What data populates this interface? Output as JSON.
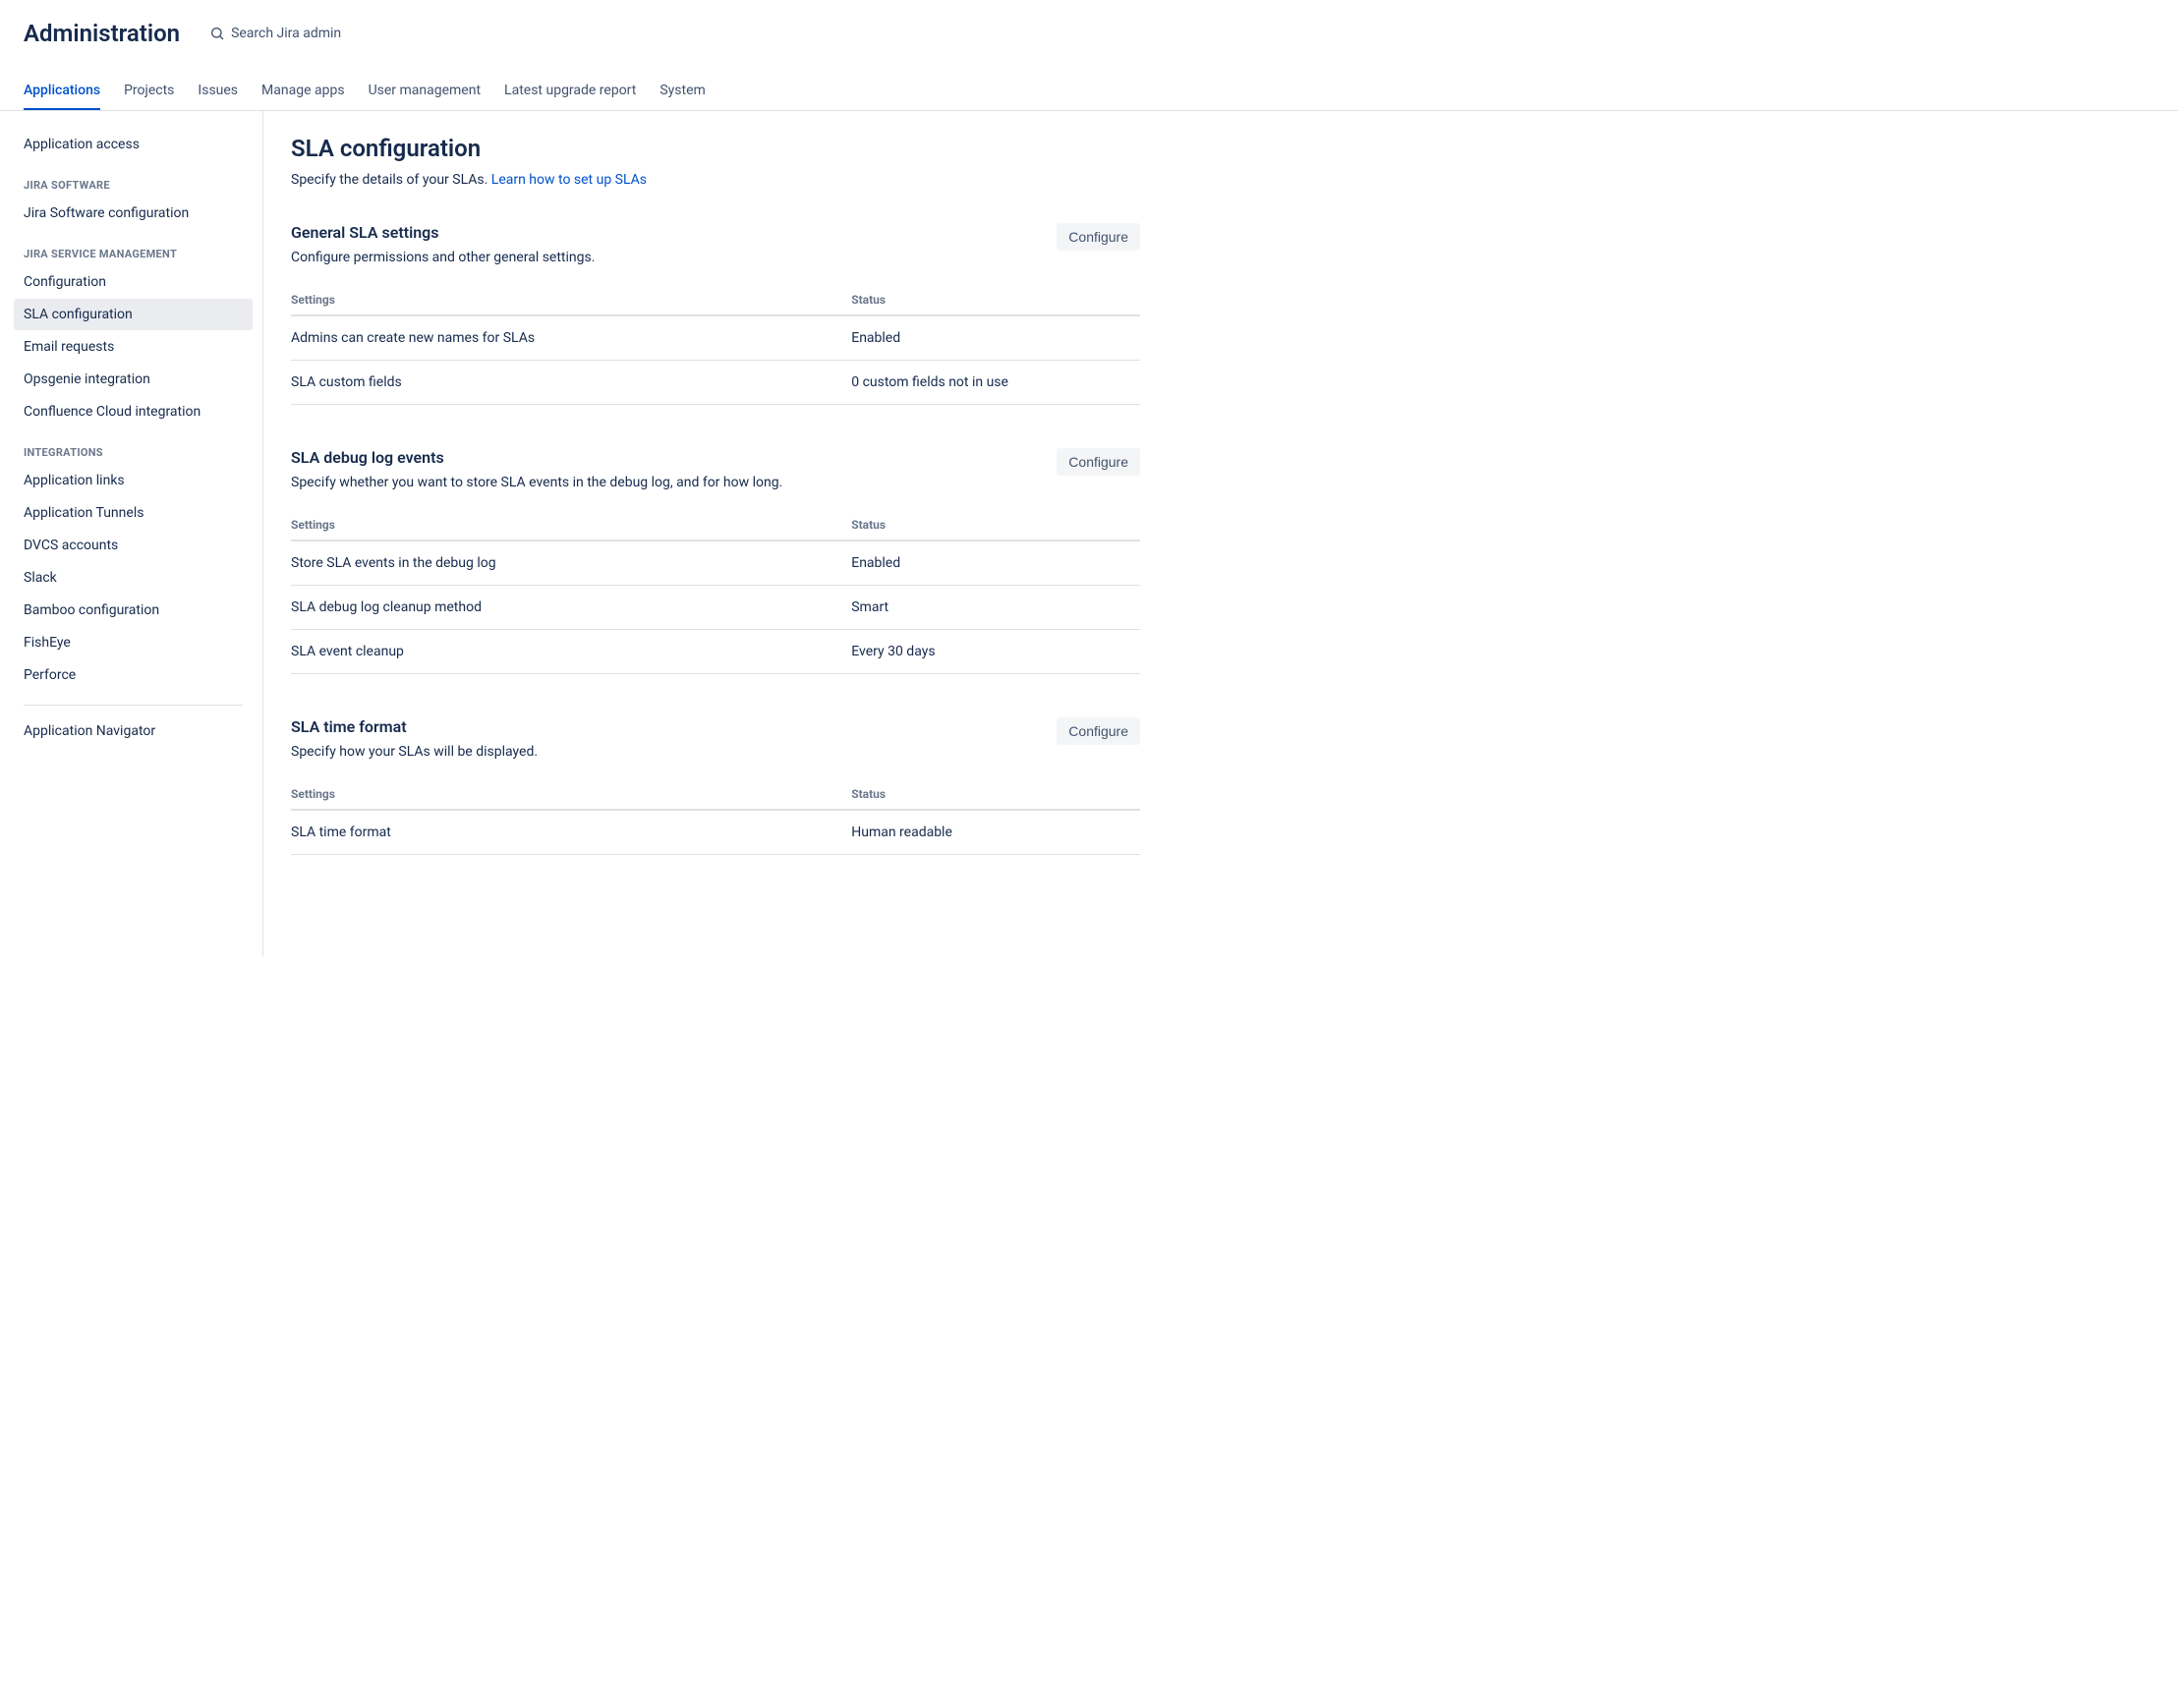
{
  "header": {
    "title": "Administration",
    "search_placeholder": "Search Jira admin"
  },
  "tabs": [
    {
      "label": "Applications",
      "active": true
    },
    {
      "label": "Projects"
    },
    {
      "label": "Issues"
    },
    {
      "label": "Manage apps"
    },
    {
      "label": "User management"
    },
    {
      "label": "Latest upgrade report"
    },
    {
      "label": "System"
    }
  ],
  "sidebar": {
    "top_item": "Application access",
    "groups": [
      {
        "heading": "JIRA SOFTWARE",
        "items": [
          {
            "label": "Jira Software configuration"
          }
        ]
      },
      {
        "heading": "JIRA SERVICE MANAGEMENT",
        "items": [
          {
            "label": "Configuration"
          },
          {
            "label": "SLA configuration",
            "active": true
          },
          {
            "label": "Email requests"
          },
          {
            "label": "Opsgenie integration"
          },
          {
            "label": "Confluence Cloud integration"
          }
        ]
      },
      {
        "heading": "INTEGRATIONS",
        "items": [
          {
            "label": "Application links"
          },
          {
            "label": "Application Tunnels"
          },
          {
            "label": "DVCS accounts"
          },
          {
            "label": "Slack"
          },
          {
            "label": "Bamboo configuration"
          },
          {
            "label": "FishEye"
          },
          {
            "label": "Perforce"
          }
        ]
      }
    ],
    "bottom_item": "Application Navigator"
  },
  "page": {
    "title": "SLA configuration",
    "description_text": "Specify the details of your SLAs. ",
    "description_link": "Learn how to set up SLAs",
    "configure_label": "Configure",
    "table_headers": {
      "settings": "Settings",
      "status": "Status"
    },
    "sections": [
      {
        "title": "General SLA settings",
        "description": "Configure permissions and other general settings.",
        "rows": [
          {
            "setting": "Admins can create new names for SLAs",
            "status": "Enabled"
          },
          {
            "setting": "SLA custom fields",
            "status": "0 custom fields not in use"
          }
        ]
      },
      {
        "title": "SLA debug log events",
        "description": "Specify whether you want to store SLA events in the debug log, and for how long.",
        "rows": [
          {
            "setting": "Store SLA events in the debug log",
            "status": "Enabled"
          },
          {
            "setting": "SLA debug log cleanup method",
            "status": "Smart"
          },
          {
            "setting": "SLA event cleanup",
            "status": "Every 30 days"
          }
        ]
      },
      {
        "title": "SLA time format",
        "description": "Specify how your SLAs will be displayed.",
        "rows": [
          {
            "setting": "SLA time format",
            "status": "Human readable"
          }
        ]
      }
    ]
  }
}
